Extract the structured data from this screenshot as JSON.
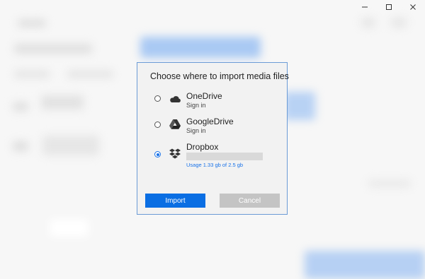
{
  "window_controls": {
    "minimize_icon": "minimize-icon",
    "maximize_icon": "maximize-icon",
    "close_icon": "close-icon"
  },
  "dialog": {
    "title": "Choose where to import media files",
    "options": [
      {
        "name": "OneDrive",
        "subtitle": "Sign in",
        "icon": "onedrive-cloud-icon",
        "selected": false
      },
      {
        "name": "GoogleDrive",
        "subtitle": "Sign in",
        "icon": "google-drive-icon",
        "selected": false
      },
      {
        "name": "Dropbox",
        "usage": "Usage 1.33 gb of 2.5 gb",
        "icon": "dropbox-icon",
        "selected": true
      }
    ],
    "import_label": "Import",
    "cancel_label": "Cancel"
  },
  "colors": {
    "accent": "#0a6ee3",
    "dialog_border": "#6b9bd6",
    "cancel_bg": "#c4c4c4",
    "usage_text": "#1a73e8"
  }
}
